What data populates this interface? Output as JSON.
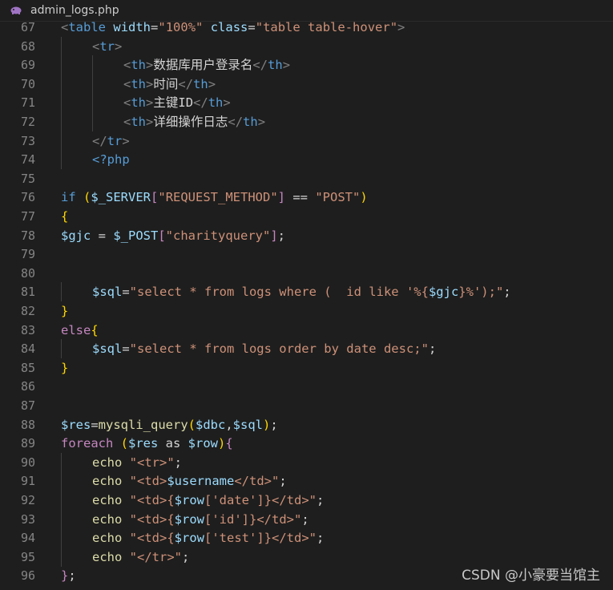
{
  "tab": {
    "filename": "admin_logs.php",
    "icon": "php-elephant-icon"
  },
  "colors": {
    "tag": "#569cd6",
    "bracket": "#808080",
    "text": "#d4d4d4",
    "string": "#ce9178",
    "variable": "#9cdcfe",
    "function": "#dcdcaa",
    "keyword": "#c586c0",
    "paren": "#ffd700",
    "paren2": "#da70d6"
  },
  "lines": [
    {
      "n": "67",
      "indent": 0,
      "tokens": [
        [
          "<",
          "b"
        ],
        [
          "table",
          "t"
        ],
        [
          " ",
          "x"
        ],
        [
          "width",
          "v"
        ],
        [
          "=",
          "x"
        ],
        [
          "\"100%\"",
          "s"
        ],
        [
          " ",
          "x"
        ],
        [
          "class",
          "v"
        ],
        [
          "=",
          "x"
        ],
        [
          "\"table table-hover\"",
          "s"
        ],
        [
          ">",
          "b"
        ]
      ]
    },
    {
      "n": "68",
      "indent": 1,
      "tokens": [
        [
          "<",
          "b"
        ],
        [
          "tr",
          "t"
        ],
        [
          ">",
          "b"
        ]
      ]
    },
    {
      "n": "69",
      "indent": 2,
      "tokens": [
        [
          "<",
          "b"
        ],
        [
          "th",
          "t"
        ],
        [
          ">",
          "b"
        ],
        [
          "数据库用户登录名",
          "x"
        ],
        [
          "</",
          "b"
        ],
        [
          "th",
          "t"
        ],
        [
          ">",
          "b"
        ]
      ]
    },
    {
      "n": "70",
      "indent": 2,
      "tokens": [
        [
          "<",
          "b"
        ],
        [
          "th",
          "t"
        ],
        [
          ">",
          "b"
        ],
        [
          "时间",
          "x"
        ],
        [
          "</",
          "b"
        ],
        [
          "th",
          "t"
        ],
        [
          ">",
          "b"
        ]
      ]
    },
    {
      "n": "71",
      "indent": 2,
      "tokens": [
        [
          "<",
          "b"
        ],
        [
          "th",
          "t"
        ],
        [
          ">",
          "b"
        ],
        [
          "主键ID",
          "x"
        ],
        [
          "</",
          "b"
        ],
        [
          "th",
          "t"
        ],
        [
          ">",
          "b"
        ]
      ]
    },
    {
      "n": "72",
      "indent": 2,
      "tokens": [
        [
          "<",
          "b"
        ],
        [
          "th",
          "t"
        ],
        [
          ">",
          "b"
        ],
        [
          "详细操作日志",
          "x"
        ],
        [
          "</",
          "b"
        ],
        [
          "th",
          "t"
        ],
        [
          ">",
          "b"
        ]
      ]
    },
    {
      "n": "73",
      "indent": 1,
      "tokens": [
        [
          "</",
          "b"
        ],
        [
          "tr",
          "t"
        ],
        [
          ">",
          "b"
        ]
      ]
    },
    {
      "n": "74",
      "indent": 1,
      "tokens": [
        [
          "<?php",
          "t"
        ]
      ]
    },
    {
      "n": "75",
      "indent": 0,
      "tokens": []
    },
    {
      "n": "76",
      "indent": 0,
      "tokens": [
        [
          "if",
          "t"
        ],
        [
          " ",
          "x"
        ],
        [
          "(",
          "p"
        ],
        [
          "$_SERVER",
          "v"
        ],
        [
          "[",
          "k"
        ],
        [
          "\"REQUEST_METHOD\"",
          "s"
        ],
        [
          "]",
          "k"
        ],
        [
          " == ",
          "x"
        ],
        [
          "\"POST\"",
          "s"
        ],
        [
          ")",
          "p"
        ]
      ]
    },
    {
      "n": "77",
      "indent": 0,
      "tokens": [
        [
          "{",
          "p"
        ]
      ]
    },
    {
      "n": "78",
      "indent": 0,
      "tokens": [
        [
          "$gjc",
          "v"
        ],
        [
          " = ",
          "x"
        ],
        [
          "$_POST",
          "v"
        ],
        [
          "[",
          "k"
        ],
        [
          "\"charityquery\"",
          "s"
        ],
        [
          "]",
          "k"
        ],
        [
          ";",
          "x"
        ]
      ]
    },
    {
      "n": "79",
      "indent": 0,
      "tokens": []
    },
    {
      "n": "80",
      "indent": 0,
      "tokens": []
    },
    {
      "n": "81",
      "indent": 1,
      "tokens": [
        [
          "$sql",
          "v"
        ],
        [
          "=",
          "x"
        ],
        [
          "\"select * from logs where (  id like '%{",
          "s"
        ],
        [
          "$gjc",
          "v"
        ],
        [
          "}%');\"",
          "s"
        ],
        [
          ";",
          "x"
        ]
      ]
    },
    {
      "n": "82",
      "indent": 0,
      "tokens": [
        [
          "}",
          "p"
        ]
      ]
    },
    {
      "n": "83",
      "indent": 0,
      "tokens": [
        [
          "else",
          "k"
        ],
        [
          "{",
          "p"
        ]
      ]
    },
    {
      "n": "84",
      "indent": 1,
      "tokens": [
        [
          "$sql",
          "v"
        ],
        [
          "=",
          "x"
        ],
        [
          "\"select * from logs order by date desc;\"",
          "s"
        ],
        [
          ";",
          "x"
        ]
      ]
    },
    {
      "n": "85",
      "indent": 0,
      "tokens": [
        [
          "}",
          "p"
        ]
      ]
    },
    {
      "n": "86",
      "indent": 0,
      "tokens": []
    },
    {
      "n": "87",
      "indent": 0,
      "tokens": []
    },
    {
      "n": "88",
      "indent": 0,
      "tokens": [
        [
          "$res",
          "v"
        ],
        [
          "=",
          "x"
        ],
        [
          "mysqli_query",
          "f"
        ],
        [
          "(",
          "p"
        ],
        [
          "$dbc",
          "v"
        ],
        [
          ",",
          "x"
        ],
        [
          "$sql",
          "v"
        ],
        [
          ")",
          "p"
        ],
        [
          ";",
          "x"
        ]
      ]
    },
    {
      "n": "89",
      "indent": 0,
      "tokens": [
        [
          "foreach",
          "k"
        ],
        [
          " ",
          "x"
        ],
        [
          "(",
          "p"
        ],
        [
          "$res",
          "v"
        ],
        [
          " as ",
          "x"
        ],
        [
          "$row",
          "v"
        ],
        [
          ")",
          "p"
        ],
        [
          "{",
          "k"
        ]
      ]
    },
    {
      "n": "90",
      "indent": 1,
      "tokens": [
        [
          "echo",
          "f"
        ],
        [
          " ",
          "x"
        ],
        [
          "\"<tr>\"",
          "s"
        ],
        [
          ";",
          "x"
        ]
      ]
    },
    {
      "n": "91",
      "indent": 1,
      "tokens": [
        [
          "echo",
          "f"
        ],
        [
          " ",
          "x"
        ],
        [
          "\"<td>",
          "s"
        ],
        [
          "$username",
          "v"
        ],
        [
          "</td>\"",
          "s"
        ],
        [
          ";",
          "x"
        ]
      ]
    },
    {
      "n": "92",
      "indent": 1,
      "tokens": [
        [
          "echo",
          "f"
        ],
        [
          " ",
          "x"
        ],
        [
          "\"<td>{",
          "s"
        ],
        [
          "$row",
          "v"
        ],
        [
          "['date']",
          "s"
        ],
        [
          "}</td>\"",
          "s"
        ],
        [
          ";",
          "x"
        ]
      ]
    },
    {
      "n": "93",
      "indent": 1,
      "tokens": [
        [
          "echo",
          "f"
        ],
        [
          " ",
          "x"
        ],
        [
          "\"<td>{",
          "s"
        ],
        [
          "$row",
          "v"
        ],
        [
          "['id']",
          "s"
        ],
        [
          "}</td>\"",
          "s"
        ],
        [
          ";",
          "x"
        ]
      ]
    },
    {
      "n": "94",
      "indent": 1,
      "tokens": [
        [
          "echo",
          "f"
        ],
        [
          " ",
          "x"
        ],
        [
          "\"<td>{",
          "s"
        ],
        [
          "$row",
          "v"
        ],
        [
          "['test']",
          "s"
        ],
        [
          "}</td>\"",
          "s"
        ],
        [
          ";",
          "x"
        ]
      ]
    },
    {
      "n": "95",
      "indent": 1,
      "tokens": [
        [
          "echo",
          "f"
        ],
        [
          " ",
          "x"
        ],
        [
          "\"</tr>\"",
          "s"
        ],
        [
          ";",
          "x"
        ]
      ]
    },
    {
      "n": "96",
      "indent": 0,
      "tokens": [
        [
          "}",
          "k"
        ],
        [
          ";",
          "x"
        ]
      ]
    }
  ],
  "watermark": "CSDN @小豪要当馆主"
}
